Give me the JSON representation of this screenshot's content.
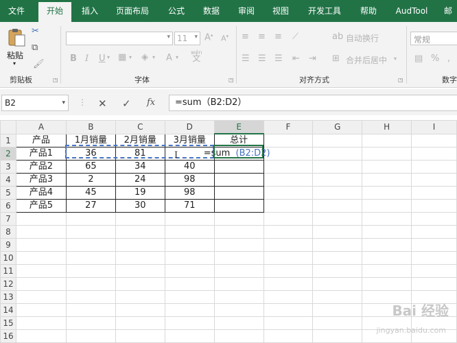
{
  "ribbon_tabs": [
    "文件",
    "开始",
    "插入",
    "页面布局",
    "公式",
    "数据",
    "审阅",
    "视图",
    "开发工具",
    "帮助",
    "AudTool",
    "邮"
  ],
  "ribbon": {
    "clipboard": {
      "paste": "粘贴",
      "label": "剪贴板"
    },
    "font": {
      "font_size": "11",
      "label": "字体",
      "phonetic": "wén"
    },
    "alignment": {
      "wrap_text": "自动换行",
      "merge_center": "合并后居中",
      "label": "对齐方式"
    },
    "number": {
      "format": "常规",
      "label": "数字"
    }
  },
  "formula_bar": {
    "name_box": "B2",
    "fx": "fx",
    "formula": "=sum（B2:D2）"
  },
  "sheet": {
    "columns": [
      "A",
      "B",
      "C",
      "D",
      "E",
      "F",
      "G",
      "H",
      "I"
    ],
    "rows": [
      "1",
      "2",
      "3",
      "4",
      "5",
      "6",
      "7",
      "8",
      "9",
      "10",
      "11",
      "12",
      "13",
      "14",
      "15",
      "16"
    ],
    "header": [
      "产品",
      "1月销量",
      "2月销量",
      "3月销量",
      "总计"
    ],
    "data": [
      [
        "产品1",
        "36",
        "81",
        "",
        ""
      ],
      [
        "产品2",
        "65",
        "34",
        "40",
        ""
      ],
      [
        "产品3",
        "2",
        "24",
        "98",
        ""
      ],
      [
        "产品4",
        "45",
        "19",
        "98",
        ""
      ],
      [
        "产品5",
        "27",
        "30",
        "71",
        ""
      ]
    ],
    "editing": {
      "func": "=sum",
      "ref": "(B2:D2)"
    }
  },
  "cursor_glyph": "I",
  "watermark": {
    "logo": "Bai 经验",
    "url": "jingyan.baidu.com"
  },
  "colors": {
    "accent": "#217346",
    "ref": "#4472c4"
  }
}
